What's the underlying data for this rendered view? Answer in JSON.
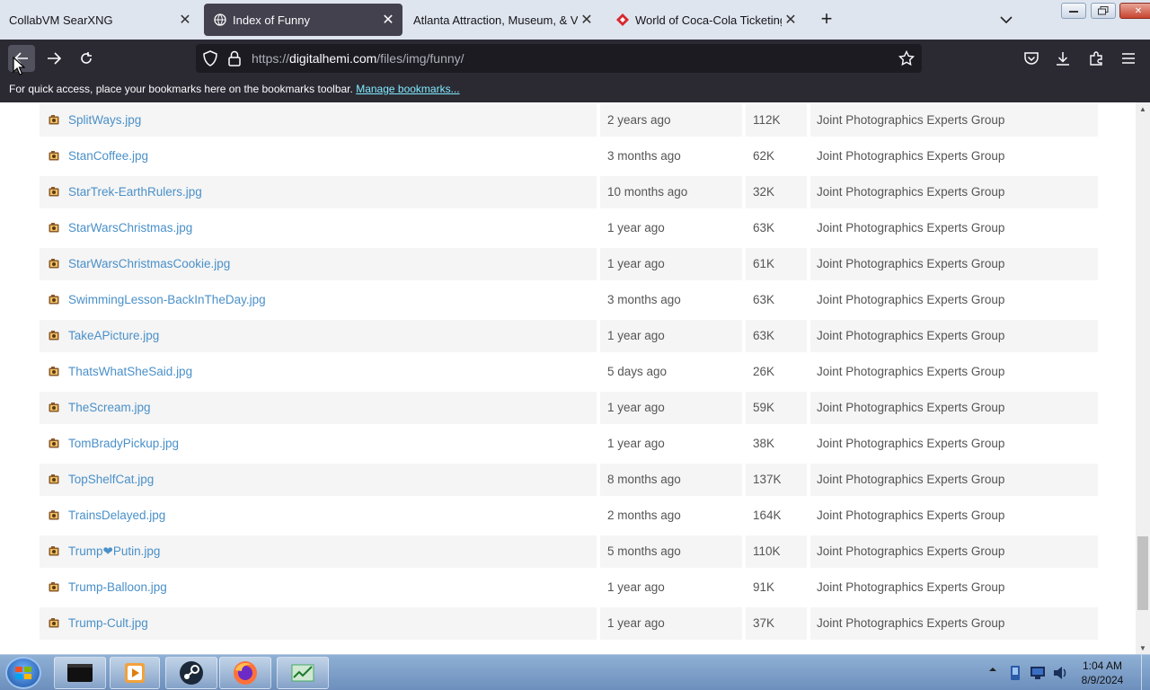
{
  "browser": {
    "tabs": [
      {
        "title": "CollabVM SearXNG",
        "active": false
      },
      {
        "title": "Index of Funny",
        "active": true
      },
      {
        "title": "Atlanta Attraction, Museum, & Ven",
        "active": false
      },
      {
        "title": "World of Coca-Cola Ticketing S",
        "active": false
      }
    ],
    "newtab_label": "+",
    "url_prefix": "https://",
    "url_host": "digitalhemi.com",
    "url_path": "/files/img/funny/",
    "bookmarks_message": "For quick access, place your bookmarks here on the bookmarks toolbar.",
    "bookmarks_link": "Manage bookmarks..."
  },
  "listing": {
    "rows": [
      {
        "name": "SplitWays.jpg",
        "date": "2 years ago",
        "size": "112K",
        "type": "Joint Photographics Experts Group"
      },
      {
        "name": "StanCoffee.jpg",
        "date": "3 months ago",
        "size": "62K",
        "type": "Joint Photographics Experts Group"
      },
      {
        "name": "StarTrek-EarthRulers.jpg",
        "date": "10 months ago",
        "size": "32K",
        "type": "Joint Photographics Experts Group"
      },
      {
        "name": "StarWarsChristmas.jpg",
        "date": "1 year ago",
        "size": "63K",
        "type": "Joint Photographics Experts Group"
      },
      {
        "name": "StarWarsChristmasCookie.jpg",
        "date": "1 year ago",
        "size": "61K",
        "type": "Joint Photographics Experts Group"
      },
      {
        "name": "SwimmingLesson-BackInTheDay.jpg",
        "date": "3 months ago",
        "size": "63K",
        "type": "Joint Photographics Experts Group"
      },
      {
        "name": "TakeAPicture.jpg",
        "date": "1 year ago",
        "size": "63K",
        "type": "Joint Photographics Experts Group"
      },
      {
        "name": "ThatsWhatSheSaid.jpg",
        "date": "5 days ago",
        "size": "26K",
        "type": "Joint Photographics Experts Group"
      },
      {
        "name": "TheScream.jpg",
        "date": "1 year ago",
        "size": "59K",
        "type": "Joint Photographics Experts Group"
      },
      {
        "name": "TomBradyPickup.jpg",
        "date": "1 year ago",
        "size": "38K",
        "type": "Joint Photographics Experts Group"
      },
      {
        "name": "TopShelfCat.jpg",
        "date": "8 months ago",
        "size": "137K",
        "type": "Joint Photographics Experts Group"
      },
      {
        "name": "TrainsDelayed.jpg",
        "date": "2 months ago",
        "size": "164K",
        "type": "Joint Photographics Experts Group"
      },
      {
        "name": "Trump❤Putin.jpg",
        "date": "5 months ago",
        "size": "110K",
        "type": "Joint Photographics Experts Group"
      },
      {
        "name": "Trump-Balloon.jpg",
        "date": "1 year ago",
        "size": "91K",
        "type": "Joint Photographics Experts Group"
      },
      {
        "name": "Trump-Cult.jpg",
        "date": "1 year ago",
        "size": "37K",
        "type": "Joint Photographics Experts Group"
      }
    ]
  },
  "scroll": {
    "position_fraction": 0.93,
    "visible_fraction": 0.14
  },
  "taskbar": {
    "clock_time": "1:04 AM",
    "clock_date": "8/9/2024",
    "apps": [
      "terminal-icon",
      "media-player-icon",
      "steam-icon",
      "firefox-icon",
      "task-manager-icon"
    ]
  },
  "colors": {
    "link": "#4a90c9",
    "row_alt": "#f5f5f5",
    "toolbar_bg": "#2b2a33",
    "tab_active_bg": "#42414d",
    "tabstrip_bg": "#dfe5ee",
    "bookmark_link": "#80ebff"
  }
}
